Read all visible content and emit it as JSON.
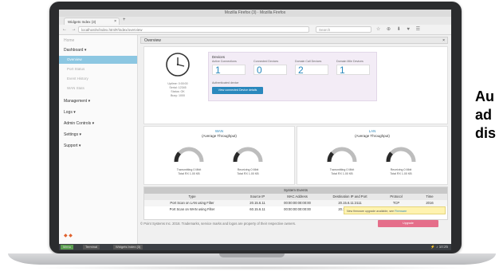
{
  "os_title": "Mozilla Firefox (3) · Mozilla Firefox",
  "browser": {
    "tab_label": "Widgets Index (3)",
    "tab_close": "×",
    "new_tab": "+",
    "nav": "← → ⟳",
    "url": "localhost/v/index.html#/index/overview",
    "search_placeholder": "Search",
    "toolbar_icons": "☆ ⊕ ⬇ ♥ ☰"
  },
  "sidebar": {
    "items": [
      {
        "label": "Home"
      },
      {
        "label": "Dashboard ▾"
      },
      {
        "label": "Overview"
      },
      {
        "label": "Port Status"
      },
      {
        "label": "Event History"
      },
      {
        "label": "WAN Stats"
      },
      {
        "label": "Management ▾"
      },
      {
        "label": "Logs ▾"
      },
      {
        "label": "Admin Controls ▾"
      },
      {
        "label": "Settings ▾"
      },
      {
        "label": "Support ▾"
      }
    ],
    "logo": "◆ ◆"
  },
  "overview": {
    "header": "Overview",
    "close": "×"
  },
  "clock": {
    "line1": "Uptime: 0:00:00",
    "line2": "Serial: 12345",
    "line3": "Status: OK",
    "line4": "Busy: 1000"
  },
  "devices": {
    "title": "Devices",
    "columns": [
      {
        "label": "Active Connections",
        "value": "1"
      },
      {
        "label": "Connected Devices",
        "value": "0"
      },
      {
        "label": "Domain Call Devices",
        "value": "2"
      },
      {
        "label": "Domain Mile Devices",
        "value": "1"
      }
    ],
    "note": "Authenticated device",
    "button": "View connected Device details"
  },
  "throughput": [
    {
      "link": "WAN",
      "title": "(Average Throughput)",
      "gauges": [
        {
          "label": "Transmitting 0 Mbit",
          "sub": "Total RX 1.00 KB"
        },
        {
          "label": "Receiving 0 Mbit",
          "sub": "Total RX 1.00 KB"
        }
      ]
    },
    {
      "link": "LAN",
      "title": "(Average Throughput)",
      "gauges": [
        {
          "label": "Transmitting 0 Mbit",
          "sub": "Total RX 1.00 KB"
        },
        {
          "label": "Receiving 0 Mbit",
          "sub": "Total RX 1.00 KB"
        }
      ]
    }
  ],
  "events": {
    "title": "System Events",
    "headers": [
      "Type",
      "Source IP",
      "MAC Address",
      "Destination IP and Port",
      "Protocol",
      "Time"
    ],
    "rows": [
      [
        "Port Scan on LAN using Filter",
        "20.15.6.11",
        "00:00:00:00:00:00",
        "20.15.6.11:2111",
        "TCP",
        "2016"
      ],
      [
        "Port Scan on WAN using Filter",
        "60.15.6.11",
        "00:00:00:00:00:00",
        "20.15.6.11:2111",
        "TCP",
        "2016"
      ]
    ]
  },
  "notice": {
    "text": "New firmware upgrade available, see ",
    "link": "Firmware"
  },
  "footer": "© Point Systems Inc. 2018. Trademarks, service marks and logos are property of their respective owners.",
  "pink_button": "Upgrade",
  "taskbar": {
    "items": [
      "Menu",
      "Terminal",
      "Widgets Index (3)"
    ],
    "tray": "⚡ ♪ 10:25"
  },
  "side_text": [
    "Au",
    "ad",
    "dis"
  ]
}
